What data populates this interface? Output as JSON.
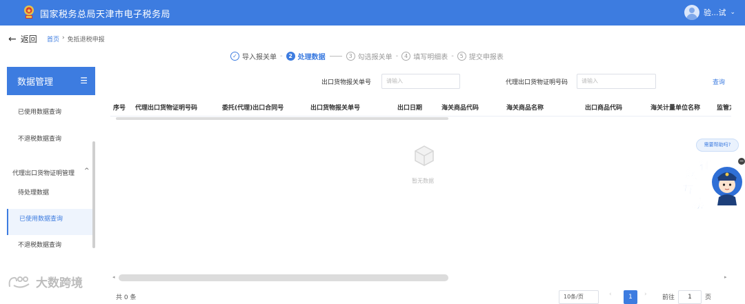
{
  "header": {
    "title": "国家税务总局天津市电子税务局",
    "user_name": "验...试",
    "caret": "⌄"
  },
  "nav": {
    "back_arrow": "←",
    "back_label": "返回",
    "breadcrumb_home": "首页",
    "breadcrumb_sep": "›",
    "breadcrumb_current": "免抵退税申报"
  },
  "steps": [
    {
      "icon": "✓",
      "label": "导入报关单",
      "state": "done"
    },
    {
      "icon": "2",
      "label": "处理数据",
      "state": "active"
    },
    {
      "icon": "3",
      "label": "勾选报关单",
      "state": "todo"
    },
    {
      "icon": "4",
      "label": "填写明细表",
      "state": "todo"
    },
    {
      "icon": "5",
      "label": "提交申报表",
      "state": "todo"
    }
  ],
  "step_sep": "-",
  "sidebar": {
    "title": "数据管理",
    "menu_icon": "☰",
    "items": [
      {
        "label": "已使用数据查询"
      },
      {
        "label": "不退税数据查询"
      }
    ],
    "group": {
      "label": "代理出口货物证明管理",
      "caret": "^",
      "items": [
        {
          "label": "待处理数据"
        },
        {
          "label": "已使用数据查询"
        },
        {
          "label": "不退税数据查询"
        }
      ]
    }
  },
  "filters": {
    "declaration_label": "出口货物报关单号",
    "declaration_placeholder": "请输入",
    "certificate_label": "代理出口货物证明号码",
    "certificate_placeholder": "请输入",
    "query_label": "查询"
  },
  "table": {
    "columns": [
      "序号",
      "代理出口货物证明号码",
      "委托(代理)出口合同号",
      "出口货物报关单号",
      "出口日期",
      "海关商品代码",
      "海关商品名称",
      "出口商品代码",
      "海关计量单位名称",
      "监管方"
    ],
    "empty_text": "暂无数据",
    "scroll_left": "◂",
    "scroll_right": "▸"
  },
  "pagination": {
    "total": "共 0 条",
    "page_size": "10条/页",
    "prev": "‹",
    "current_page": "1",
    "next": "›",
    "jump_label": "前往",
    "jump_value": "1",
    "jump_suffix": "页"
  },
  "help": {
    "bubble": "需要帮助吗?",
    "close": "−",
    "chars": [
      "征",
      "纳",
      "互",
      "动"
    ]
  },
  "watermark": {
    "text": "大数跨境"
  },
  "colors": {
    "primary": "#3d7ce0",
    "sidebar_selected_bg": "#eef4fd"
  }
}
